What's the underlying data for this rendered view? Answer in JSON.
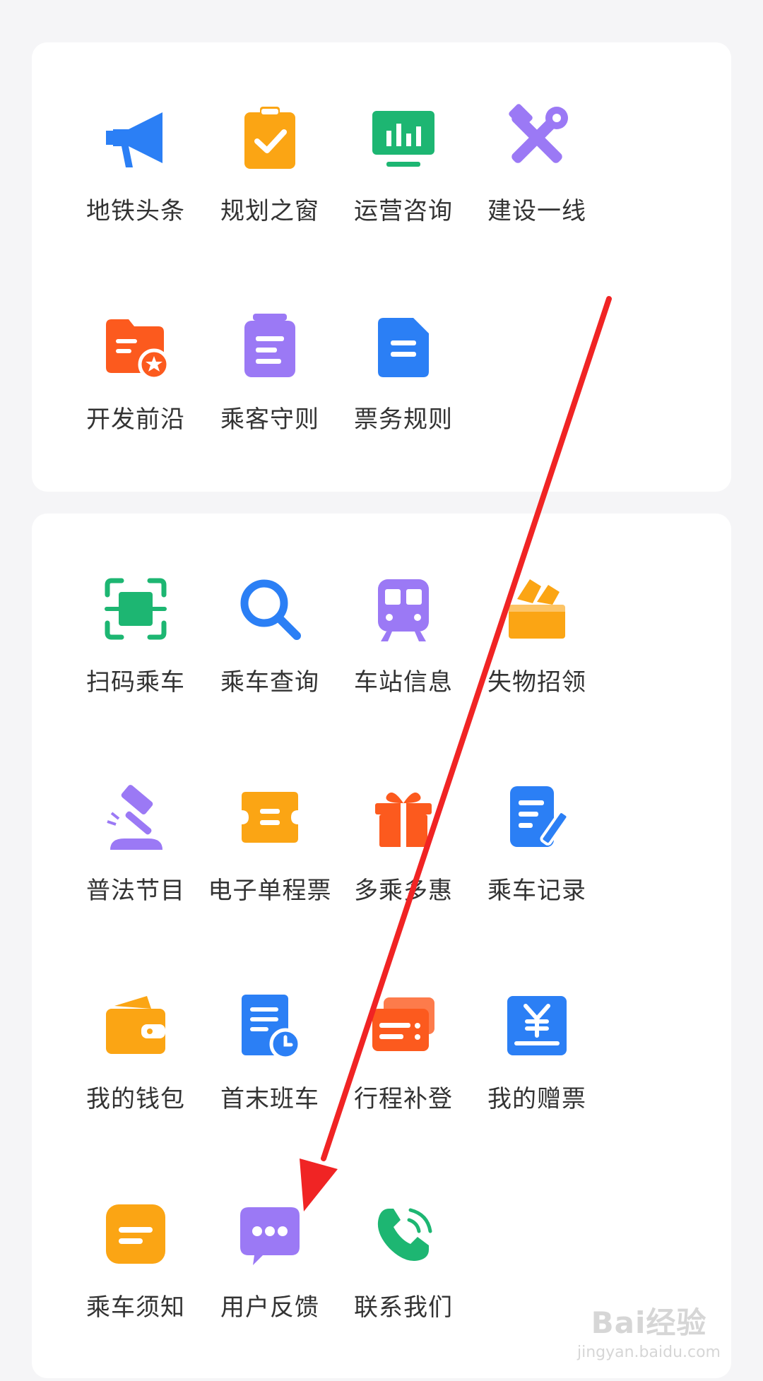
{
  "sections": [
    {
      "items": [
        {
          "label": "地铁头条",
          "icon": "megaphone-icon"
        },
        {
          "label": "规划之窗",
          "icon": "clipboard-check-icon"
        },
        {
          "label": "运营咨询",
          "icon": "monitor-chart-icon"
        },
        {
          "label": "建设一线",
          "icon": "tools-icon"
        },
        {
          "label": "开发前沿",
          "icon": "star-folder-icon"
        },
        {
          "label": "乘客守则",
          "icon": "notepad-icon"
        },
        {
          "label": "票务规则",
          "icon": "document-icon"
        }
      ]
    },
    {
      "items": [
        {
          "label": "扫码乘车",
          "icon": "scan-icon"
        },
        {
          "label": "乘车查询",
          "icon": "search-icon"
        },
        {
          "label": "车站信息",
          "icon": "train-icon"
        },
        {
          "label": "失物招领",
          "icon": "lost-box-icon"
        },
        {
          "label": "普法节目",
          "icon": "gavel-icon"
        },
        {
          "label": "电子单程票",
          "icon": "ticket-icon"
        },
        {
          "label": "多乘多惠",
          "icon": "gift-icon"
        },
        {
          "label": "乘车记录",
          "icon": "record-edit-icon"
        },
        {
          "label": "我的钱包",
          "icon": "wallet-icon"
        },
        {
          "label": "首末班车",
          "icon": "schedule-icon"
        },
        {
          "label": "行程补登",
          "icon": "cards-icon"
        },
        {
          "label": "我的赠票",
          "icon": "yuan-ticket-icon"
        },
        {
          "label": "乘车须知",
          "icon": "notice-icon"
        },
        {
          "label": "用户反馈",
          "icon": "chat-bubble-icon"
        },
        {
          "label": "联系我们",
          "icon": "phone-icon"
        }
      ]
    }
  ],
  "colors": {
    "blue": "#2b7ff5",
    "orange": "#fba514",
    "green": "#1db672",
    "purple": "#9b79f5",
    "red_orange": "#fc5a1e",
    "annotation_arrow": "#f02424"
  },
  "watermark": {
    "brand": "Bai经验",
    "url": "jingyan.baidu.com"
  }
}
